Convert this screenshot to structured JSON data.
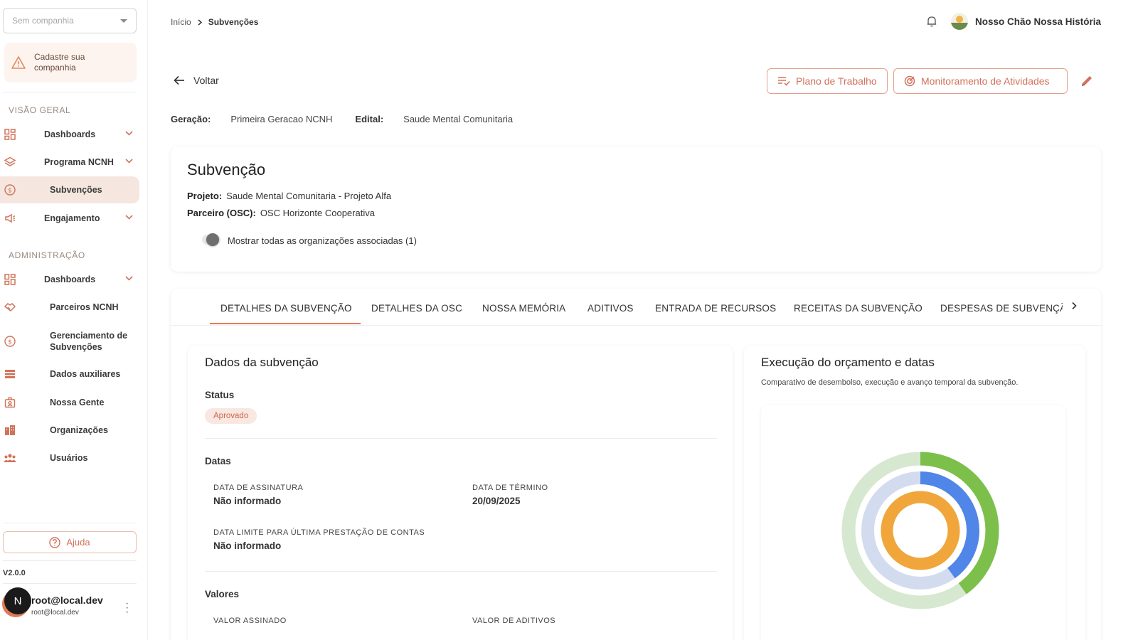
{
  "sidebar": {
    "company_placeholder": "Sem companhia",
    "warning_text": "Cadastre sua companhia",
    "section_overview": "VISÃO GERAL",
    "overview_items": [
      {
        "label": "Dashboards",
        "icon": "dashboard-grid-icon"
      },
      {
        "label": "Programa NCNH",
        "icon": "layers-icon"
      },
      {
        "label": "Subvenções",
        "icon": "dollar-circle-icon"
      },
      {
        "label": "Engajamento",
        "icon": "megaphone-icon"
      }
    ],
    "section_admin": "ADMINISTRAÇÃO",
    "admin_items": [
      {
        "label": "Dashboards",
        "icon": "dashboard-grid-icon"
      },
      {
        "label": "Parceiros NCNH",
        "icon": "handshake-icon"
      },
      {
        "label": "Gerenciamento de Subvenções",
        "icon": "dollar-circle-icon"
      },
      {
        "label": "Dados auxiliares",
        "icon": "list-icon"
      },
      {
        "label": "Nossa Gente",
        "icon": "id-badge-icon"
      },
      {
        "label": "Organizações",
        "icon": "building-icon"
      },
      {
        "label": "Usuários",
        "icon": "users-icon"
      }
    ],
    "help_label": "Ajuda",
    "version": "V2.0.0",
    "user": {
      "initial": "N",
      "name": "root@local.dev",
      "email": "root@local.dev"
    }
  },
  "header": {
    "breadcrumb_home": "Início",
    "breadcrumb_current": "Subvenções",
    "org_name": "Nosso Chão Nossa História"
  },
  "actions": {
    "back_label": "Voltar",
    "work_plan_label": "Plano de Trabalho",
    "monitoring_label": "Monitoramento de Atividades"
  },
  "meta": {
    "generation_label": "Geração:",
    "generation_value": "Primeira Geracao NCNH",
    "edital_label": "Edital:",
    "edital_value": "Saude Mental Comunitaria"
  },
  "subvencao": {
    "title": "Subvenção",
    "project_label": "Projeto:",
    "project_value": "Saude Mental Comunitaria - Projeto Alfa",
    "partner_label": "Parceiro (OSC):",
    "partner_value": "OSC Horizonte Cooperativa",
    "toggle_label": "Mostrar todas as organizações associadas (1)",
    "toggle_on": false
  },
  "tabs": [
    "DETALHES DA SUBVENÇÃO",
    "DETALHES DA OSC",
    "NOSSA MEMÓRIA",
    "ADITIVOS",
    "ENTRADA DE RECURSOS",
    "RECEITAS DA SUBVENÇÃO",
    "DESPESAS DE SUBVENÇÃO"
  ],
  "dados": {
    "title": "Dados da subvenção",
    "status_label": "Status",
    "status_value": "Aprovado",
    "dates_label": "Datas",
    "signature_label": "DATA DE ASSINATURA",
    "signature_value": "Não informado",
    "end_label": "DATA DE TÉRMINO",
    "end_value": "20/09/2025",
    "limit_label": "DATA LIMITE PARA ÚLTIMA PRESTAÇÃO DE CONTAS",
    "limit_value": "Não informado",
    "values_label": "Valores",
    "signed_value_label": "VALOR ASSINADO",
    "amendments_value_label": "VALOR DE ADITIVOS"
  },
  "execucao": {
    "title": "Execução do orçamento e datas",
    "description": "Comparativo de desembolso, execução e avanço temporal da subvenção."
  },
  "chart_data": {
    "type": "radial-progress",
    "rings": [
      {
        "color": "#7cc04b",
        "track": "#d6e8d0",
        "fraction": 0.4
      },
      {
        "color": "#4f86e8",
        "track": "#d3dcef",
        "fraction": 0.4
      },
      {
        "color": "#f0a63a",
        "track": "#f7e2c4",
        "fraction": 1.0
      }
    ]
  },
  "colors": {
    "accent": "#e07a58",
    "active_nav_bg": "#f5e7df",
    "status_badge_bg": "#f9e7e1"
  }
}
